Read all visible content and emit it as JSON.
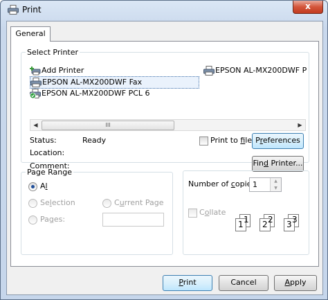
{
  "window": {
    "title": "Print",
    "close_label": "x"
  },
  "tabs": [
    {
      "label": "General"
    }
  ],
  "select_printer": {
    "legend": "Select Printer",
    "items": [
      {
        "label": "Add Printer",
        "icon": "add-printer-icon"
      },
      {
        "label": "EPSON AL-MX200DWF P",
        "icon": "printer-icon"
      },
      {
        "label": "EPSON AL-MX200DWF Fax",
        "icon": "printer-icon",
        "selected": true
      },
      {
        "label": "EPSON AL-MX200DWF PCL 6",
        "icon": "default-printer-icon"
      }
    ],
    "scroll_thumb_glyph": "III",
    "status_label": "Status:",
    "status_value": "Ready",
    "location_label": "Location:",
    "comment_label": "Comment:",
    "print_to_file": {
      "pre": "Print to ",
      "key": "f",
      "post": "ile",
      "checked": false
    },
    "preferences": {
      "pre": "P",
      "key": "r",
      "post": "eferences"
    },
    "find_printer": {
      "pre": "Fin",
      "key": "d",
      "post": " Printer..."
    }
  },
  "page_range": {
    "legend": "Page Range",
    "all": {
      "key": "l",
      "pre": "A",
      "post": "",
      "checked": true
    },
    "selection": {
      "pre": "Se",
      "key": "l",
      "post": "ection",
      "enabled": false
    },
    "current_page": {
      "pre": "C",
      "key": "u",
      "post": "rrent Page",
      "enabled": false
    },
    "pages": {
      "pre": "Pa",
      "key": "g",
      "post": "es:",
      "enabled": false,
      "value": ""
    }
  },
  "copies": {
    "label_pre": "Number of ",
    "label_key": "c",
    "label_post": "opies:",
    "value": "1",
    "collate": {
      "pre": "C",
      "key": "o",
      "post": "llate",
      "checked": false,
      "enabled": false
    },
    "collate_pages": [
      "1",
      "1",
      "2",
      "2",
      "3",
      "3"
    ]
  },
  "buttons": {
    "print": {
      "pre": "",
      "key": "P",
      "post": "rint"
    },
    "cancel": "Cancel",
    "apply": {
      "pre": "",
      "key": "A",
      "post": "pply"
    }
  }
}
